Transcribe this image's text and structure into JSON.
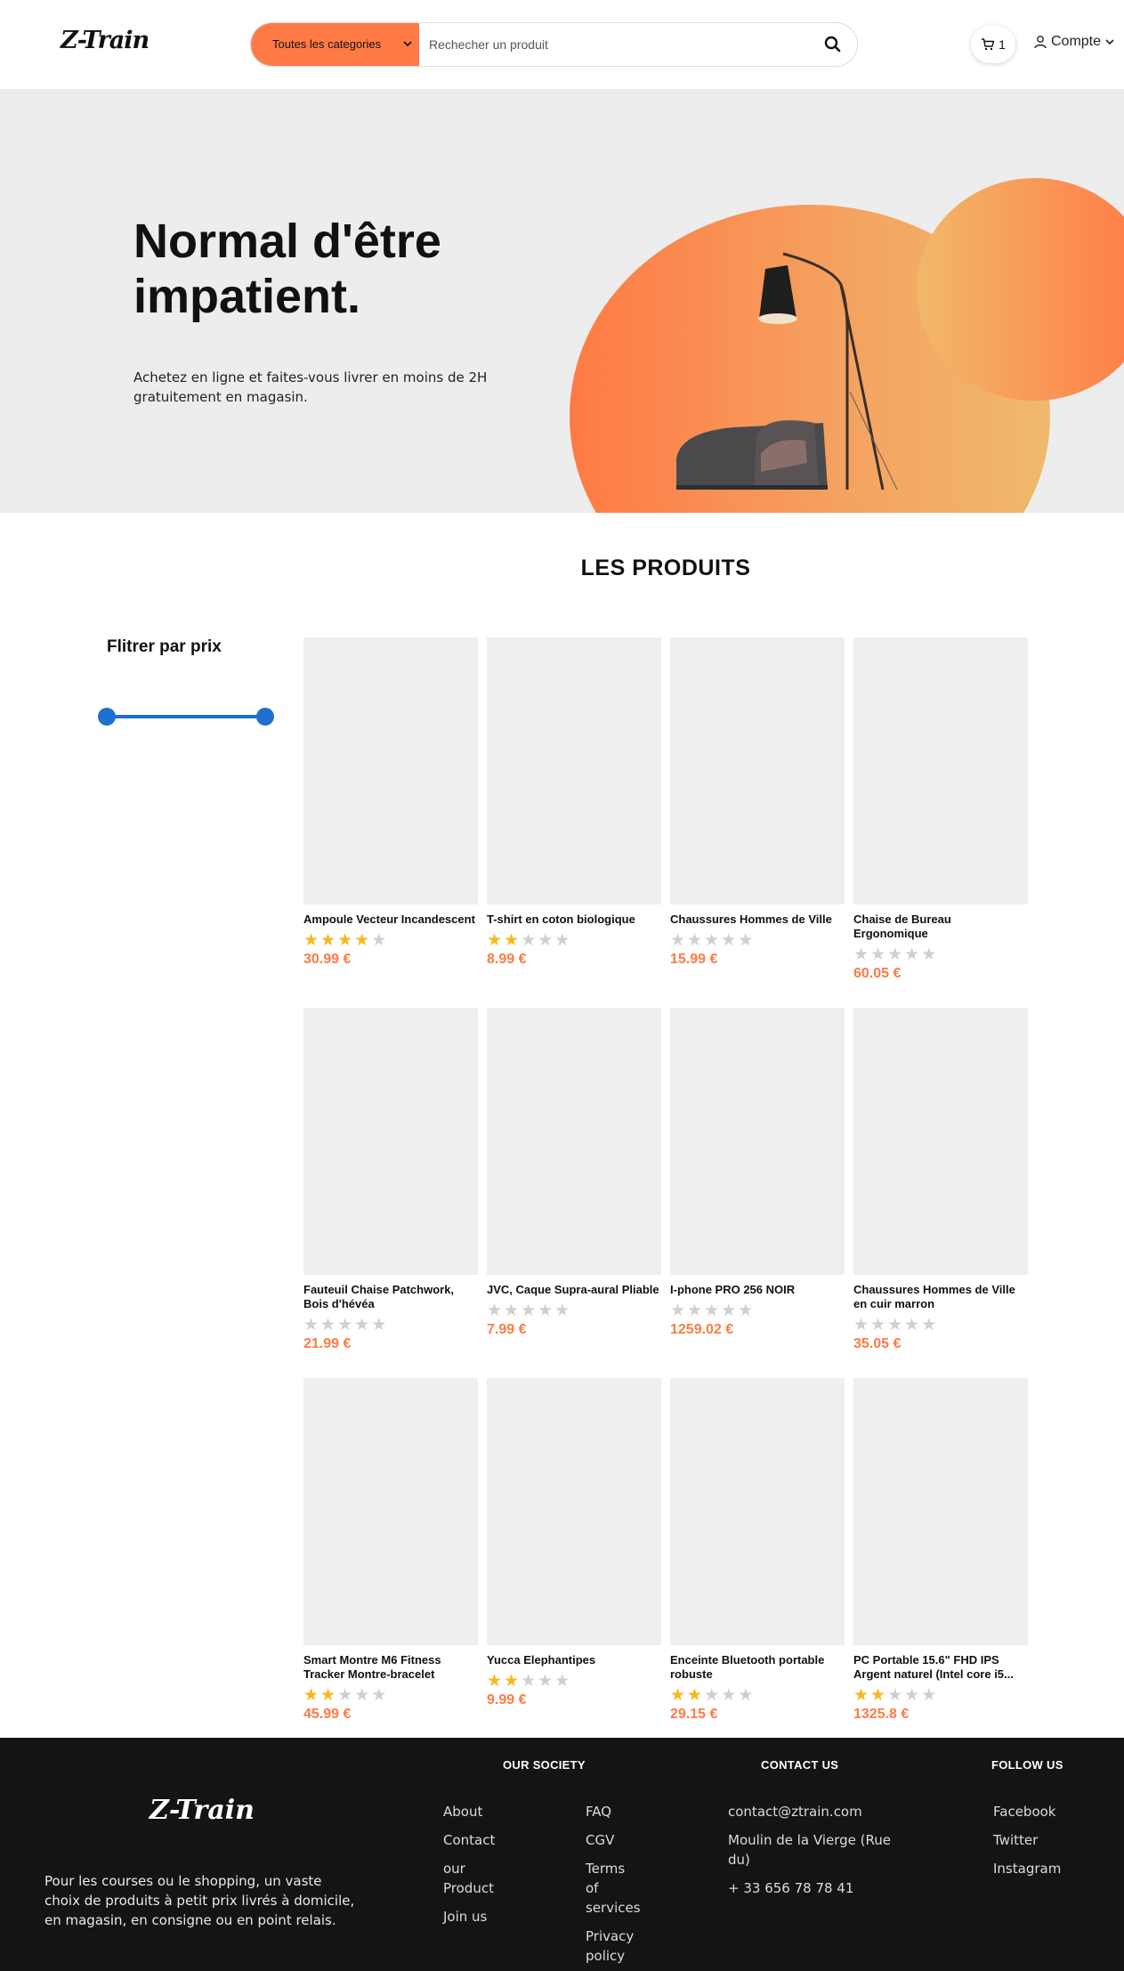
{
  "header": {
    "logo": "Z-Train",
    "category_select": "Toutes les categories",
    "search_placeholder": "Rechecher un produit",
    "cart_count": "1",
    "account_label": "Compte"
  },
  "hero": {
    "title_line1": "Normal d'être",
    "title_line2": "impatient.",
    "subtitle": "Achetez en ligne et faites-vous livrer en moins de 2H gratuitement en magasin."
  },
  "products_section": {
    "title": "LES PRODUITS",
    "filter_title": "Flitrer par prix"
  },
  "products": [
    {
      "name": "Ampoule Vecteur Incandescent",
      "rating": 4,
      "price": "30.99 €"
    },
    {
      "name": "T-shirt en coton biologique",
      "rating": 2,
      "price": "8.99 €"
    },
    {
      "name": "Chaussures Hommes de Ville",
      "rating": 0,
      "price": "15.99 €"
    },
    {
      "name": "Chaise de Bureau Ergonomique",
      "rating": 0,
      "price": "60.05 €"
    },
    {
      "name": "Fauteuil Chaise Patchwork, Bois d'hévéa",
      "rating": 0,
      "price": "21.99 €"
    },
    {
      "name": "JVC, Caque Supra-aural Pliable",
      "rating": 0,
      "price": "7.99 €"
    },
    {
      "name": "I-phone PRO 256 NOIR",
      "rating": 0,
      "price": "1259.02 €"
    },
    {
      "name": "Chaussures Hommes de Ville en cuir marron",
      "rating": 0,
      "price": "35.05 €"
    },
    {
      "name": "Smart Montre M6 Fitness Tracker Montre-bracelet",
      "rating": 2,
      "price": "45.99 €"
    },
    {
      "name": "Yucca Elephantipes",
      "rating": 2,
      "price": "9.99 €"
    },
    {
      "name": "Enceinte Bluetooth portable robuste",
      "rating": 2,
      "price": "29.15 €"
    },
    {
      "name": "PC Portable 15.6\" FHD IPS Argent naturel (Intel core i5...",
      "rating": 2,
      "price": "1325.8 €"
    }
  ],
  "footer": {
    "logo": "Z-Train",
    "description": "Pour les courses ou le shopping, un vaste choix de produits à petit prix livrés à domicile, en magasin, en consigne ou en point relais.",
    "society_title": "OUR SOCIETY",
    "society_col1": [
      "About",
      "Contact",
      "our Product",
      "Join us"
    ],
    "society_col2": [
      "FAQ",
      "CGV",
      "Terms of services",
      "Privacy policy"
    ],
    "contact_title": "CONTACT US",
    "contact": [
      "contact@ztrain.com",
      "Moulin de la Vierge (Rue du)",
      "+ 33 656 78 78 41"
    ],
    "follow_title": "FOLLOW US",
    "follow": [
      "Facebook",
      "Twitter",
      "Instagram"
    ]
  },
  "colors": {
    "accent": "#ff7a45",
    "star": "#f6b91c",
    "slider": "#1f6fd1",
    "footer_bg": "#141414"
  }
}
